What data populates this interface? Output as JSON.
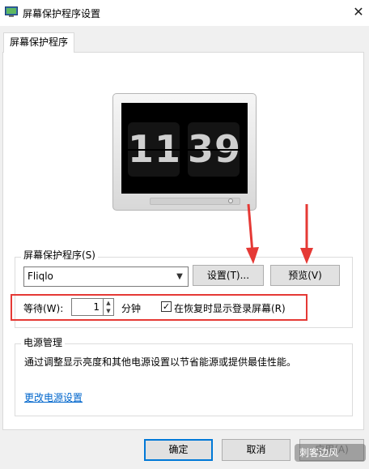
{
  "window": {
    "title": "屏幕保护程序设置",
    "close_glyph": "✕"
  },
  "tabs": [
    {
      "label": "屏幕保护程序"
    }
  ],
  "preview": {
    "clock_hours": "11",
    "clock_minutes": "39"
  },
  "screensaver": {
    "group_title": "屏幕保护程序(S)",
    "selected": "Fliqlo",
    "settings_button": "设置(T)...",
    "preview_button": "预览(V)",
    "wait_label": "等待(W):",
    "wait_value": "1",
    "minutes_label": "分钟",
    "resume_checkbox_label": "在恢复时显示登录屏幕(R)",
    "resume_checked": true
  },
  "power": {
    "group_title": "电源管理",
    "description": "通过调整显示亮度和其他电源设置以节省能源或提供最佳性能。",
    "link": "更改电源设置"
  },
  "footer": {
    "ok": "确定",
    "cancel": "取消",
    "apply": "应用(A)"
  },
  "watermark": "刺客边风",
  "colors": {
    "annotation_red": "#e53935",
    "link_blue": "#0066cc",
    "focus_blue": "#0078d7"
  }
}
